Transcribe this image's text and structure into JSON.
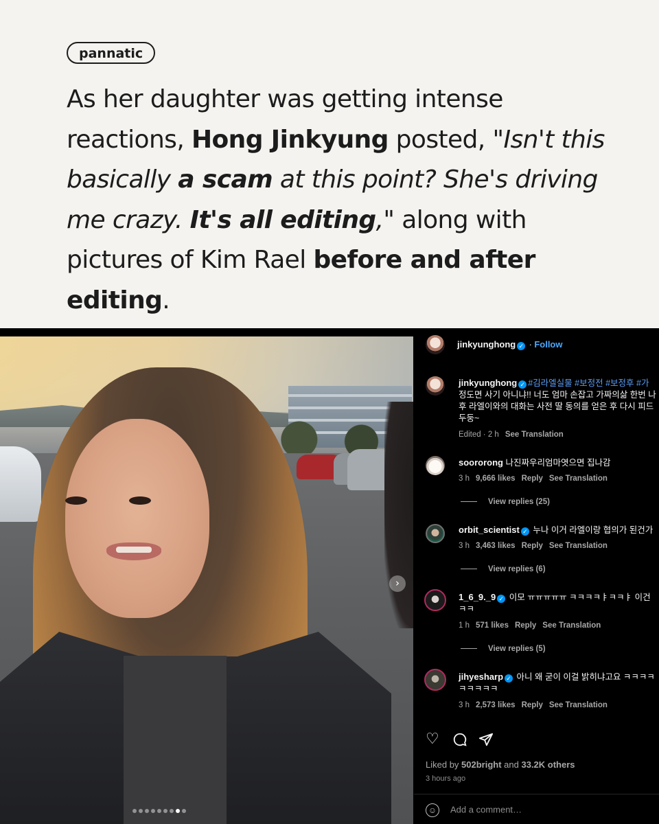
{
  "brand": "pannatic",
  "headline": {
    "p1": "As her daughter was getting intense reactions, ",
    "p2": "Hong Jinkyung",
    "p3": " posted, ",
    "q1": "\"Isn't this basically ",
    "q2": "a scam",
    "q3": " at this point? She's driving me crazy. ",
    "q4": "It's all editing",
    "q5": ",\"",
    "p4": " along with pictures of Kim Rael ",
    "p5": "before and after editing",
    "p6": "."
  },
  "post": {
    "author": "jinkyunghong",
    "follow": "Follow",
    "caption_user": "jinkyunghong",
    "caption_tags": "#김라엘실물 #보정전 #보정후 #가",
    "caption_line2": "정도면 사기 아니냐!! 너도 엄마 손잡고 가짜의삶 한번 나",
    "caption_line3": "후 라엘이와의 대화는 사전 딸 동의를 얻은 후 다시 피드",
    "caption_line4": "두둥~",
    "caption_meta": "Edited · 2 h",
    "see_translation": "See Translation"
  },
  "comments": [
    {
      "user": "soororong",
      "verified": false,
      "text": "나진짜우리엄마엿으면 집나감",
      "text2": "",
      "time": "3 h",
      "likes": "9,666 likes",
      "reply": "Reply",
      "translate": "See Translation",
      "replies": "View replies (25)"
    },
    {
      "user": "orbit_scientist",
      "verified": true,
      "text": "누나 이거 라엘이랑 협의가 된건가",
      "text2": "",
      "time": "3 h",
      "likes": "3,463 likes",
      "reply": "Reply",
      "translate": "See Translation",
      "replies": "View replies (6)"
    },
    {
      "user": "1_6_9._9",
      "verified": true,
      "text": "이모 ㅠㅠㅠㅠㅠ ㅋㅋㅋㅋㅑㅋㅋㅑ 이건",
      "text2": "ㅋㅋ",
      "time": "1 h",
      "likes": "571 likes",
      "reply": "Reply",
      "translate": "See Translation",
      "replies": "View replies (5)"
    },
    {
      "user": "jihyesharp",
      "verified": true,
      "text": "아니 왜 굳이 이걸 밝히냐고요 ㅋㅋㅋㅋ",
      "text2": "ㅋㅋㅋㅋㅋ",
      "time": "3 h",
      "likes": "2,573 likes",
      "reply": "Reply",
      "translate": "See Translation",
      "replies": ""
    }
  ],
  "footer": {
    "liked_prefix": "Liked by ",
    "liked_user": "502bright",
    "liked_mid": " and ",
    "liked_count": "33.2K others",
    "time_ago": "3 hours ago",
    "comment_placeholder": "Add a comment…"
  },
  "icons": {
    "like": "heart-icon",
    "comment": "comment-icon",
    "share": "share-icon",
    "emoji": "emoji-icon",
    "next": "chevron-right-icon"
  },
  "colors": {
    "link": "#4ea8ff",
    "verified": "#0095f6",
    "panel_bg": "#000000",
    "card_bg": "#f4f3f0"
  },
  "carousel": {
    "count": 9,
    "active": 8
  }
}
